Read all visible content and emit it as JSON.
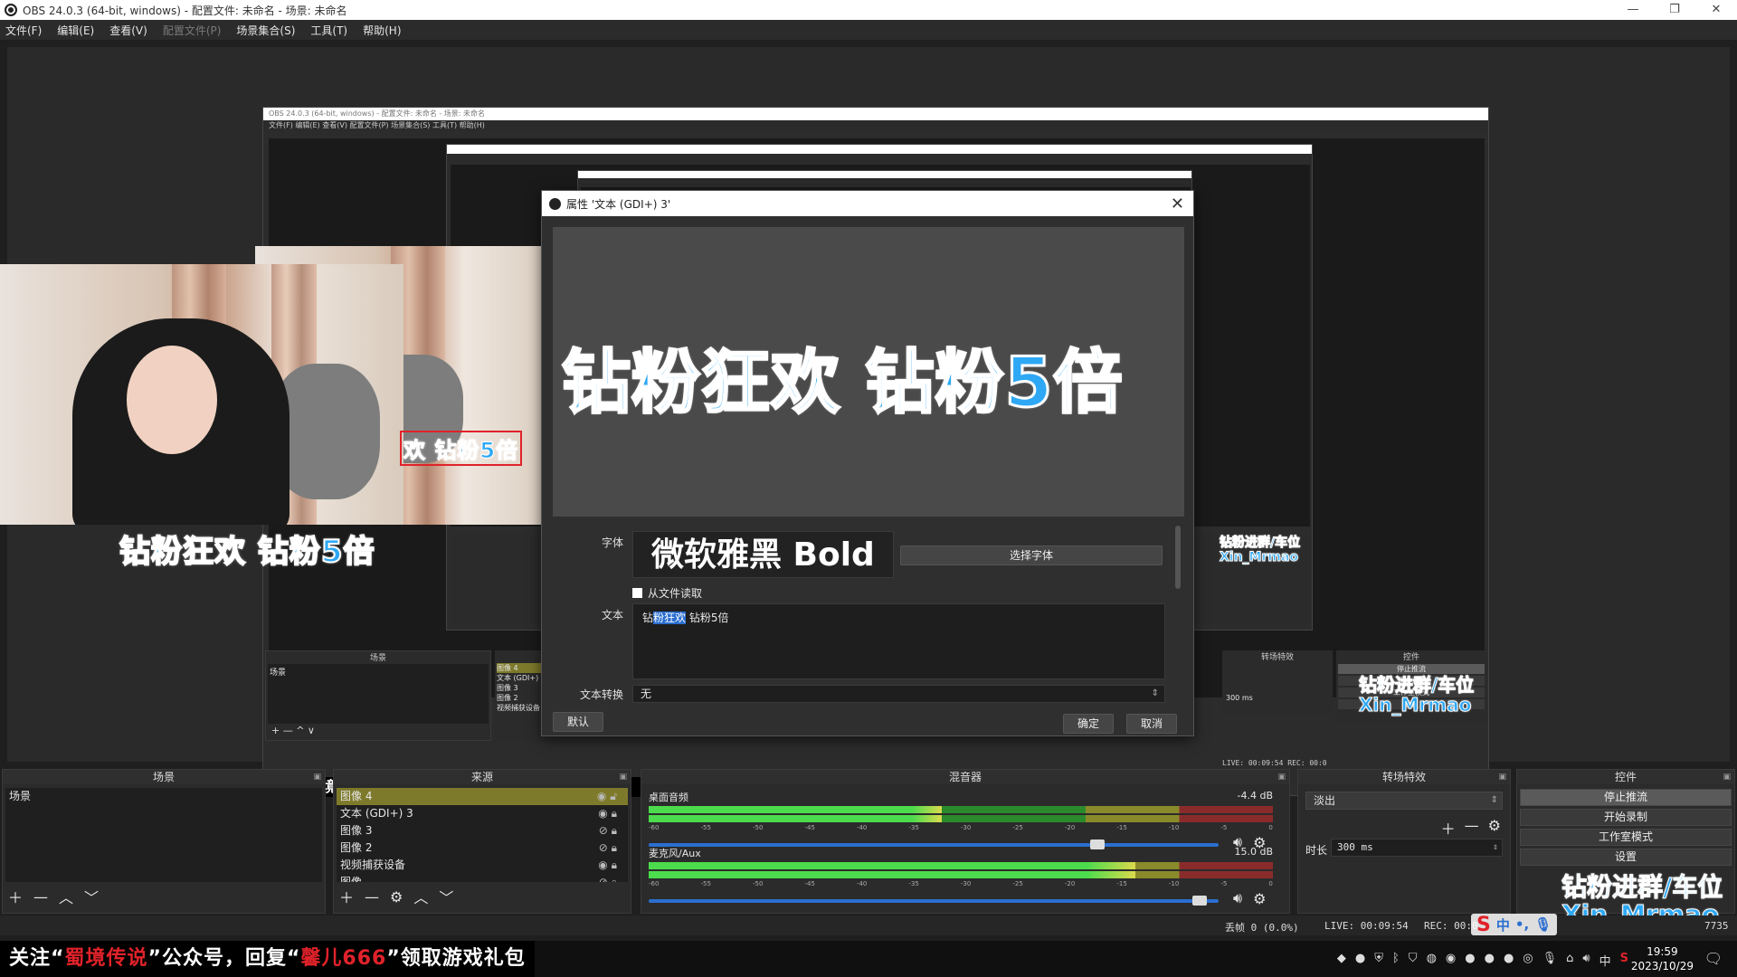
{
  "window": {
    "title": "OBS 24.0.3 (64-bit, windows) - 配置文件: 未命名 - 场景: 未命名",
    "minimize": "—",
    "restore": "❐",
    "close": "✕"
  },
  "menu": [
    {
      "label": "文件(F)",
      "disabled": false
    },
    {
      "label": "编辑(E)",
      "disabled": false
    },
    {
      "label": "查看(V)",
      "disabled": false
    },
    {
      "label": "配置文件(P)",
      "disabled": true
    },
    {
      "label": "场景集合(S)",
      "disabled": false
    },
    {
      "label": "工具(T)",
      "disabled": false
    },
    {
      "label": "帮助(H)",
      "disabled": false
    }
  ],
  "preview": {
    "overlay_text": "钻粉狂欢 钻粉5倍",
    "overlay_text_partial": "欢 钻粉5倍",
    "banner": "关注“蜀境传说”公众号，回复“馨儿666”领取游戏礼包",
    "banner_short": "关注“蜀境传说”公",
    "nested_scene_header": "场景",
    "nested_scene_item": "场景",
    "nested_sources": [
      "图像 4",
      "文本 (GDI+) 3",
      "图像 3",
      "图像 2",
      "视频捕获设备"
    ],
    "nested_transition_header": "转场特效",
    "nested_controls_header": "控件",
    "nested_controls": [
      "停止推流",
      "开始录制",
      "工作室模式",
      "设置"
    ],
    "nested_duration": "300 ms",
    "nested_status": "LIVE: 00:09:54   REC: 00:0"
  },
  "dialog": {
    "title": "属性 '文本 (GDI+) 3'",
    "close": "✕",
    "preview_text": "钻粉狂欢 钻粉5倍",
    "font_label": "字体",
    "font_value": "微软雅黑 Bold",
    "choose_font": "选择字体",
    "from_file": "从文件读取",
    "text_label": "文本",
    "text_value_pre": "钻",
    "text_value_sel": "粉狂欢",
    "text_value_post": " 钻粉5倍",
    "transform_label": "文本转换",
    "transform_value": "无",
    "defaults": "默认",
    "ok": "确定",
    "cancel": "取消"
  },
  "scenes": {
    "header": "场景",
    "items": [
      "场景"
    ]
  },
  "sources": {
    "header": "来源",
    "items": [
      {
        "label": "图像 4",
        "active": true,
        "visible": true
      },
      {
        "label": "文本 (GDI+) 3",
        "active": false,
        "visible": true
      },
      {
        "label": "图像 3",
        "active": false,
        "visible": false
      },
      {
        "label": "图像 2",
        "active": false,
        "visible": false
      },
      {
        "label": "视频捕获设备",
        "active": false,
        "visible": true
      },
      {
        "label": "图像",
        "active": false,
        "visible": false
      }
    ]
  },
  "mixer": {
    "header": "混音器",
    "channels": [
      {
        "name": "桌面音频",
        "db": "-4.4 dB",
        "level": 0.47,
        "volume": 0.8
      },
      {
        "name": "麦克风/Aux",
        "db": "15.0 dB",
        "level": 0.78,
        "volume": 0.98
      }
    ],
    "ticks": [
      "-60",
      "-55",
      "-50",
      "-45",
      "-40",
      "-35",
      "-30",
      "-25",
      "-20",
      "-15",
      "-10",
      "-5",
      "0"
    ]
  },
  "transitions": {
    "header": "转场特效",
    "selected": "淡出",
    "duration_label": "时长",
    "duration_value": "300 ms"
  },
  "controls": {
    "header": "控件",
    "buttons": [
      "停止推流",
      "开始录制",
      "工作室模式",
      "设置"
    ]
  },
  "status": {
    "dropped": "丢帧 0 (0.0%)",
    "live": "LIVE: 00:09:54",
    "rec": "REC: 00:0",
    "extra": "7735"
  },
  "watermark": {
    "line1": "钻粉进群/车位",
    "line2": "Xin_Mrmao"
  },
  "ime": {
    "logo": "S",
    "lang": "中",
    "punct": "•,"
  },
  "taskbar": {
    "notice_a": "关注“",
    "notice_b": "蜀境传说",
    "notice_c": "”公众号，回复“",
    "notice_d": "馨儿666",
    "notice_e": "”领取游戏礼包",
    "time": "19:59",
    "date": "2023/10/29",
    "tray_lang": "中"
  }
}
